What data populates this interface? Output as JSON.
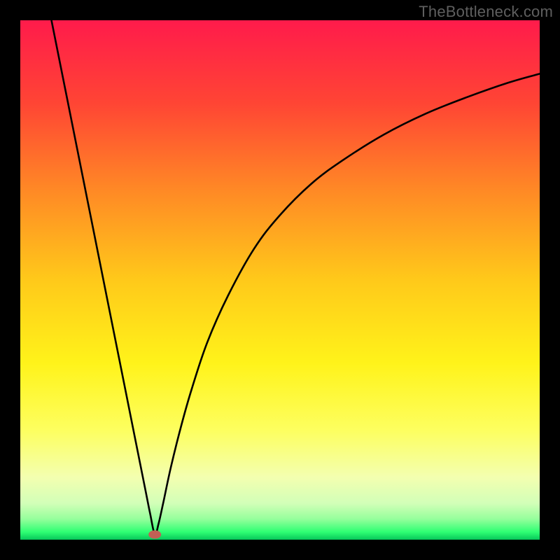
{
  "watermark": "TheBottleneck.com",
  "chart_data": {
    "type": "line",
    "title": "",
    "xlabel": "",
    "ylabel": "",
    "xlim": [
      0,
      100
    ],
    "ylim": [
      0,
      100
    ],
    "background_gradient": {
      "stops": [
        {
          "offset": 0.0,
          "color": "#ff1b4b"
        },
        {
          "offset": 0.16,
          "color": "#ff4534"
        },
        {
          "offset": 0.33,
          "color": "#ff8a25"
        },
        {
          "offset": 0.5,
          "color": "#ffc91a"
        },
        {
          "offset": 0.66,
          "color": "#fff31a"
        },
        {
          "offset": 0.79,
          "color": "#fdff60"
        },
        {
          "offset": 0.88,
          "color": "#f3ffb0"
        },
        {
          "offset": 0.93,
          "color": "#d2ffb8"
        },
        {
          "offset": 0.96,
          "color": "#96ff9c"
        },
        {
          "offset": 0.985,
          "color": "#2fff73"
        },
        {
          "offset": 1.0,
          "color": "#07c85a"
        }
      ]
    },
    "curve_minimum_x": 25.9,
    "marker": {
      "x": 25.9,
      "y": 1.0,
      "color": "#c26055"
    },
    "curve": [
      {
        "x": 6.0,
        "y": 100.0
      },
      {
        "x": 8.0,
        "y": 90.0
      },
      {
        "x": 10.0,
        "y": 80.0
      },
      {
        "x": 12.0,
        "y": 70.0
      },
      {
        "x": 14.0,
        "y": 60.0
      },
      {
        "x": 16.0,
        "y": 50.0
      },
      {
        "x": 18.0,
        "y": 40.0
      },
      {
        "x": 20.0,
        "y": 30.0
      },
      {
        "x": 22.0,
        "y": 20.0
      },
      {
        "x": 24.0,
        "y": 10.0
      },
      {
        "x": 25.0,
        "y": 5.0
      },
      {
        "x": 25.9,
        "y": 1.0
      },
      {
        "x": 26.6,
        "y": 3.0
      },
      {
        "x": 27.5,
        "y": 7.0
      },
      {
        "x": 29.0,
        "y": 14.0
      },
      {
        "x": 31.0,
        "y": 22.0
      },
      {
        "x": 33.0,
        "y": 29.0
      },
      {
        "x": 36.0,
        "y": 38.0
      },
      {
        "x": 40.0,
        "y": 47.0
      },
      {
        "x": 45.0,
        "y": 56.0
      },
      {
        "x": 50.0,
        "y": 62.5
      },
      {
        "x": 56.0,
        "y": 68.5
      },
      {
        "x": 62.0,
        "y": 73.0
      },
      {
        "x": 70.0,
        "y": 78.0
      },
      {
        "x": 78.0,
        "y": 82.0
      },
      {
        "x": 86.0,
        "y": 85.2
      },
      {
        "x": 94.0,
        "y": 88.0
      },
      {
        "x": 100.0,
        "y": 89.7
      }
    ]
  }
}
